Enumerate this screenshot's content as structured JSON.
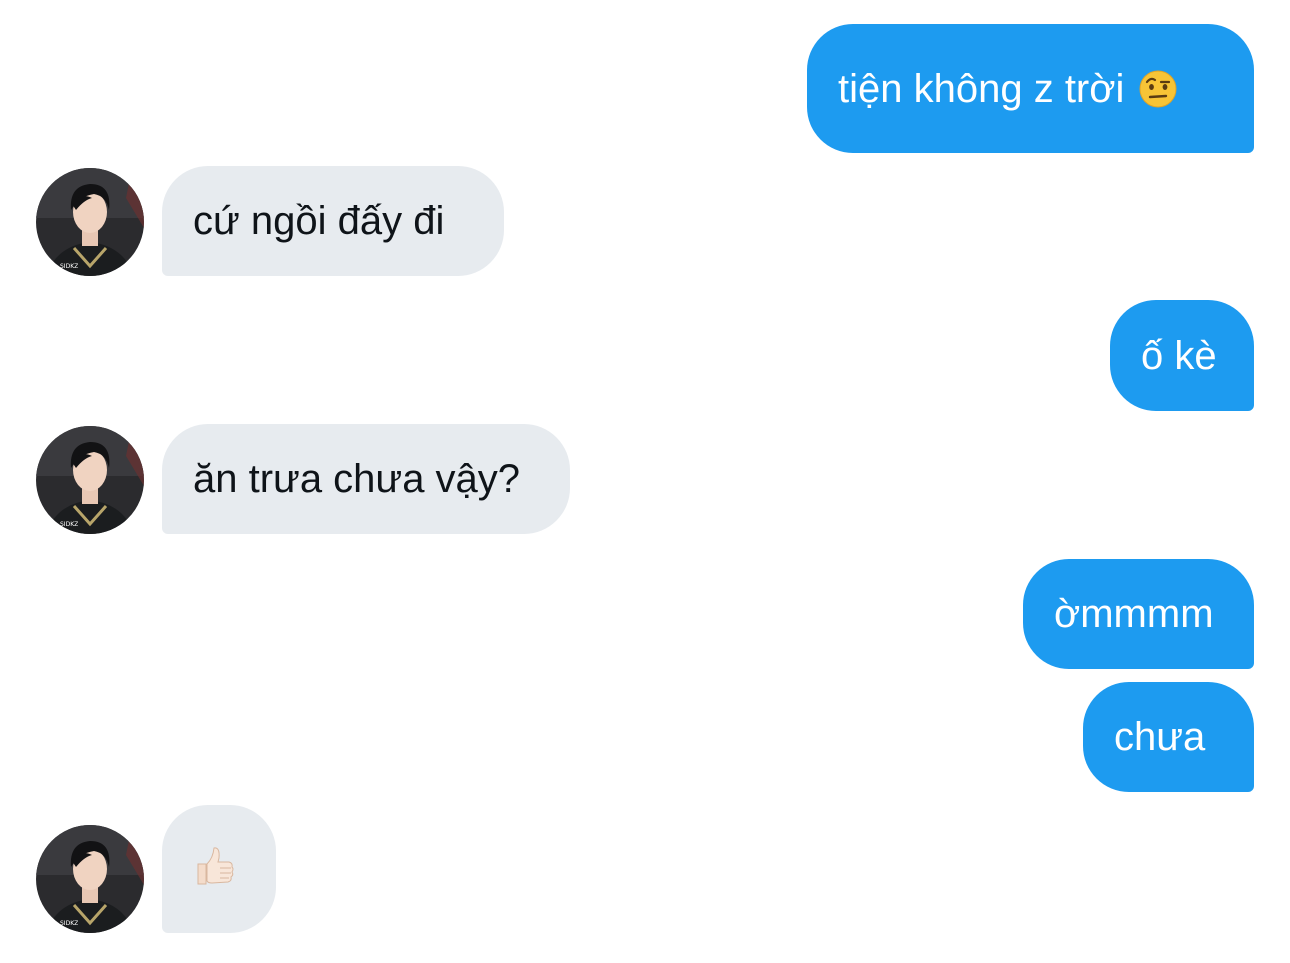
{
  "conversation": {
    "messages": [
      {
        "side": "sent",
        "text": "tiện không z trời",
        "emoji": "face-with-raised-eyebrow-emoji"
      },
      {
        "side": "received",
        "text": "cứ ngồi đấy đi"
      },
      {
        "side": "sent",
        "text": "ố kè"
      },
      {
        "side": "received",
        "text": "ăn trưa chưa vậy?"
      },
      {
        "side": "sent",
        "text": "ờmmmm"
      },
      {
        "side": "sent",
        "text": "chưa"
      },
      {
        "side": "received",
        "emoji": "thumbs-up-emoji"
      }
    ]
  },
  "colors": {
    "sent_bubble": "#1d9bf0",
    "received_bubble": "#e7ebef",
    "sent_text": "#ffffff",
    "received_text": "#0f1419"
  }
}
